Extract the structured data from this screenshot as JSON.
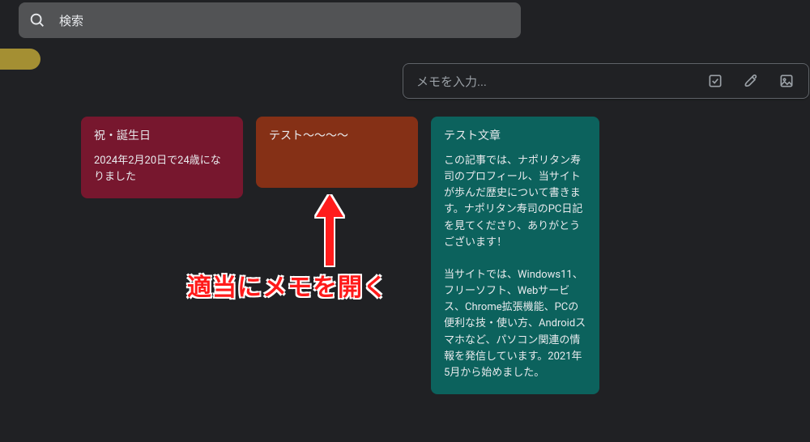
{
  "search": {
    "placeholder": "検索"
  },
  "note_input": {
    "placeholder": "メモを入力..."
  },
  "notes": [
    {
      "color_key": "red",
      "title": "祝・誕生日",
      "body": "2024年2月20日で24歳になりました"
    },
    {
      "color_key": "brown",
      "title": "テスト～～～～",
      "body": ""
    },
    {
      "color_key": "teal",
      "title": "テスト文章",
      "body": "この記事では、ナポリタン寿司のプロフィール、当サイトが歩んだ歴史について書きます。ナポリタン寿司のPC日記を見てくださり、ありがとうございます！\n\n当サイトでは、Windows11、フリーソフト、Webサービス、Chrome拡張機能、PCの便利な技・使い方、Androidスマホなど、パソコン関連の情報を発信しています。2021年5月から始めました。"
    }
  ],
  "annotation": {
    "text": "適当にメモを開く"
  },
  "icons": {
    "checkbox": "checkbox-icon",
    "brush": "brush-icon",
    "image": "image-icon"
  }
}
